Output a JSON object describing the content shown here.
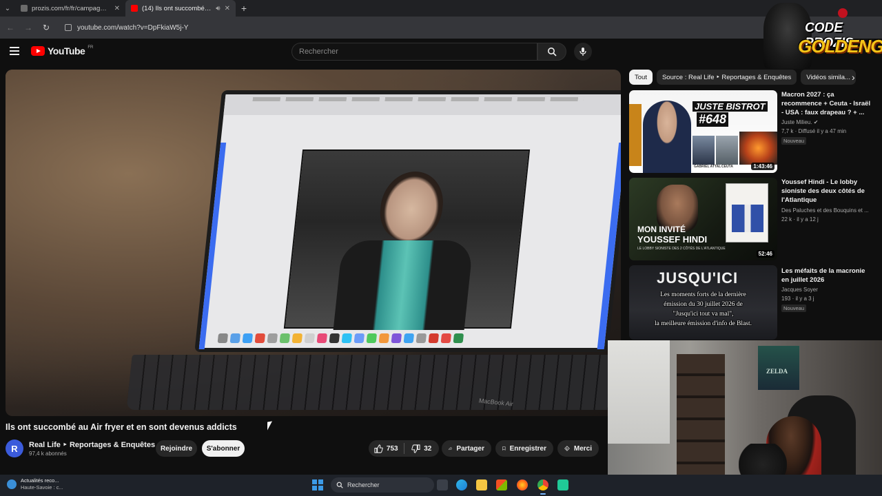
{
  "browser": {
    "tabs": [
      {
        "title": "prozis.com/fr/fr/campagne/74...",
        "favicon_color": "#6b6b6b",
        "active": false
      },
      {
        "title": "(14) Ils ont succombé au Ai...",
        "favicon_color": "#ff0000",
        "active": true
      }
    ],
    "url": "youtube.com/watch?v=DpFkiaW5j-Y"
  },
  "youtube": {
    "logo_text": "YouTube",
    "country": "FR",
    "search_placeholder": "Rechercher"
  },
  "overlay_logo": {
    "line1": "CODE PROZIS",
    "line2": "GOLDENG"
  },
  "video": {
    "title": "Ils ont succombé au Air fryer et en sont devenus addicts",
    "laptop_label": "MacBook Air",
    "channel": {
      "initial": "R",
      "name": "Real Life ‣ Reportages & Enquêtes",
      "subscribers": "97,4 k abonnés"
    },
    "buttons": {
      "join": "Rejoindre",
      "subscribe": "S'abonner",
      "likes": "753",
      "dislikes": "32",
      "share": "Partager",
      "save": "Enregistrer",
      "thanks": "Merci"
    }
  },
  "chips": [
    "Tout",
    "Source : Real Life ‣ Reportages & Enquêtes",
    "Vidéos simila..."
  ],
  "recommendations": [
    {
      "title": "Macron 2027 : ça recommence + Ceuta - Israël - USA : faux drapeau ? + ...",
      "channel": "Juste Milieu.",
      "meta": "7,7 k · Diffusé il y a 47 min",
      "badge": "Nouveau",
      "duration": "1:43:46",
      "thumb_text": [
        "JUSTE BISTROT",
        "#648"
      ],
      "thumb_caps": [
        "GABRIEL ATTAL",
        "CEUTA"
      ]
    },
    {
      "title": "Youssef Hindi - Le lobby sioniste des deux côtés de l'Atlantique",
      "channel": "Des Paluches et des Bouquins et ...",
      "meta": "22 k · il y a 12 j",
      "duration": "52:46",
      "thumb_text": [
        "MON INVITÉ",
        "YOUSSEF HINDI",
        "LE LOBBY SIONISTE DES 2 CÔTÉS DE L'ATLANTIQUE"
      ]
    },
    {
      "title": "Les méfaits de la macronie en juillet 2026",
      "channel": "Jacques Soyer",
      "meta": "193 · il y a 3 j",
      "badge": "Nouveau",
      "thumb_text": [
        "JUSQU'ICI",
        "Les moments forts de la dernière",
        "émission du 30 juillet 2026 de",
        "\"Jusqu'ici tout va mal\",",
        "la meilleure émission d'info de Blast."
      ]
    }
  ],
  "webcam": {
    "poster_text": "ZELDA"
  },
  "taskbar": {
    "weather_title": "Actualités reco...",
    "weather_sub": "Haute-Savoie : c...",
    "search_label": "Rechercher"
  }
}
